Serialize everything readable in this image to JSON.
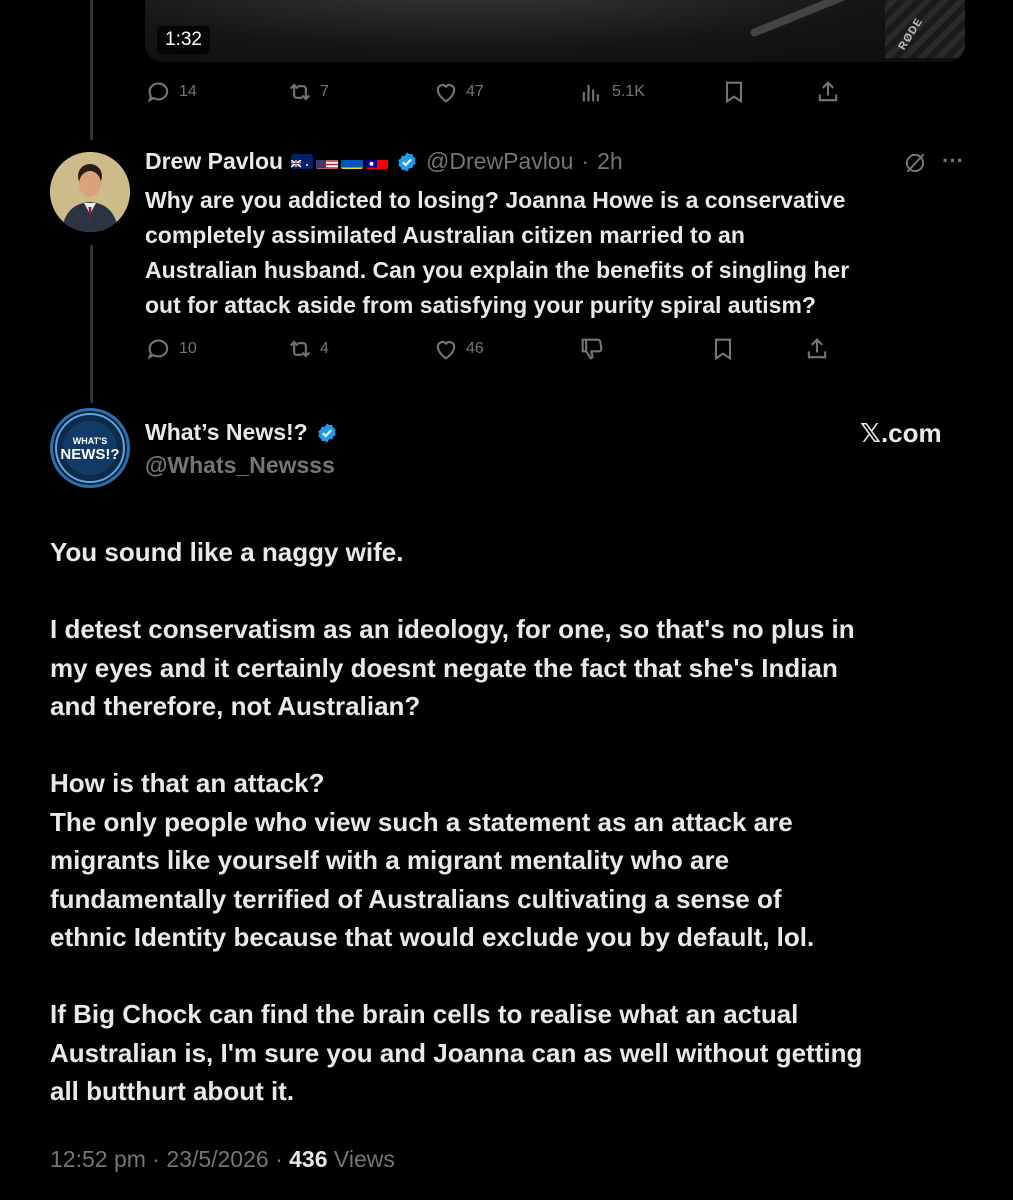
{
  "top_tweet": {
    "video_duration": "1:32",
    "mic_brand": "RØDE",
    "actions": {
      "replies": "14",
      "reposts": "7",
      "likes": "47",
      "views": "5.1K"
    }
  },
  "reply_tweet": {
    "name": "Drew Pavlou",
    "handle": "@DrewPavlou",
    "separator": "·",
    "time": "2h",
    "more": "···",
    "lines": [
      "Why are you addicted to losing? Joanna Howe is a conservative",
      "completely assimilated Australian citizen married to an",
      "Australian husband. Can you explain the benefits of singling her",
      "out for attack aside from satisfying your purity spiral autism?"
    ],
    "actions": {
      "replies": "10",
      "reposts": "4",
      "likes": "46"
    }
  },
  "main_tweet": {
    "name": "What’s News!?",
    "handle": "@Whats_Newsss",
    "avatar_text_top": "WHAT'S",
    "avatar_text_bottom": "NEWS!?",
    "source": "𝕏.com",
    "paragraphs": [
      [
        "You sound like a naggy wife."
      ],
      [
        "I detest conservatism as an ideology, for one, so that's no plus in",
        "my eyes and it certainly doesnt negate the fact that she's Indian",
        "and therefore, not Australian?"
      ],
      [
        "How is that an attack?",
        "The only people who view such a statement as an attack are",
        "migrants like yourself with a migrant mentality who are",
        "fundamentally terrified of Australians cultivating a sense of",
        "ethnic Identity because that would exclude you by default, lol."
      ],
      [
        "If Big Chock can find the brain cells to realise what an actual",
        "Australian is, I'm sure you and Joanna can as well without getting",
        "all butthurt about it."
      ]
    ],
    "time": "12:52 pm",
    "date": "23/5/2026",
    "sep": "·",
    "view_count": "436",
    "views_label": "Views"
  },
  "colors": {
    "background": "#000000",
    "text": "#e7e9ea",
    "muted": "#71767b",
    "verified": "#1d9bf0"
  }
}
